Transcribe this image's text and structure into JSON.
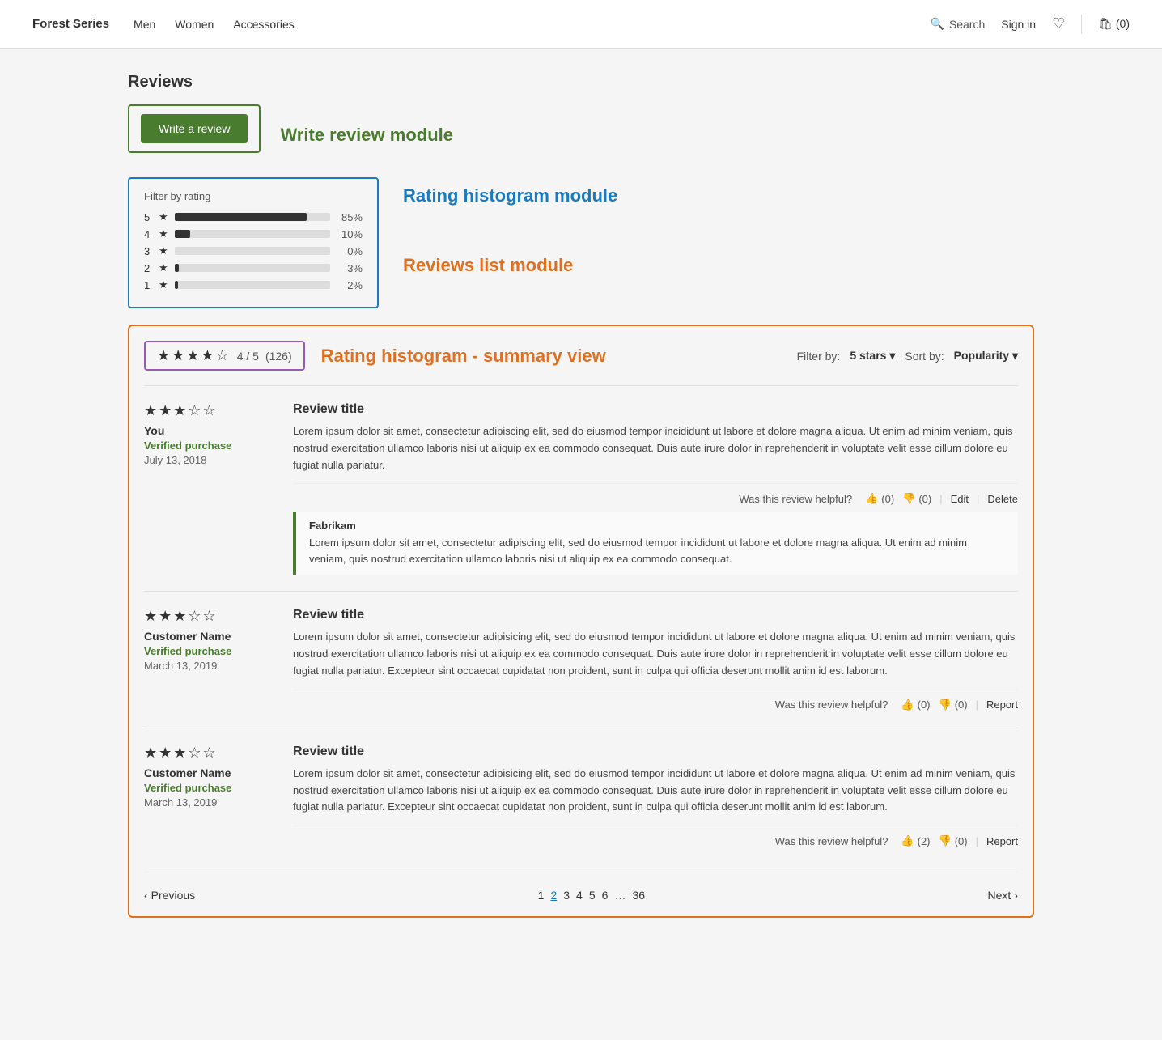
{
  "nav": {
    "brand": "Forest Series",
    "links": [
      "Men",
      "Women",
      "Accessories"
    ],
    "search_label": "Search",
    "signin_label": "Sign in",
    "cart_label": "(0)"
  },
  "page": {
    "reviews_title": "Reviews",
    "write_review_btn": "Write a review",
    "write_review_module_label": "Write review module",
    "histogram_module_label": "Rating histogram module",
    "reviews_list_module_label": "Reviews list module",
    "histogram_summary_label": "Rating histogram - summary view",
    "histogram": {
      "title": "Filter by rating",
      "rows": [
        {
          "num": "5",
          "pct": 85,
          "pct_label": "85%"
        },
        {
          "num": "4",
          "pct": 10,
          "pct_label": "10%"
        },
        {
          "num": "3",
          "pct": 0,
          "pct_label": "0%"
        },
        {
          "num": "2",
          "pct": 3,
          "pct_label": "3%"
        },
        {
          "num": "1",
          "pct": 2,
          "pct_label": "2%"
        }
      ]
    },
    "summary": {
      "score": "4 / 5",
      "count": "(126)"
    },
    "filter_by_label": "Filter by:",
    "filter_by_value": "5 stars ▾",
    "sort_by_label": "Sort by:",
    "sort_by_value": "Popularity ▾",
    "reviews": [
      {
        "stars": 3,
        "author": "You",
        "verified": "Verified purchase",
        "date": "July 13, 2018",
        "title": "Review title",
        "body": "Lorem ipsum dolor sit amet, consectetur adipiscing elit, sed do eiusmod tempor incididunt ut labore et dolore magna aliqua. Ut enim ad minim veniam, quis nostrud exercitation ullamco laboris nisi ut aliquip ex ea commodo consequat. Duis aute irure dolor in reprehenderit in voluptate velit esse cillum dolore eu fugiat nulla pariatur.",
        "helpful_label": "Was this review helpful?",
        "thumbs_up": "(0)",
        "thumbs_down": "(0)",
        "actions": [
          "Edit",
          "Delete"
        ],
        "response": {
          "author": "Fabrikam",
          "body": "Lorem ipsum dolor sit amet, consectetur adipiscing elit, sed do eiusmod tempor incididunt ut labore et dolore magna aliqua. Ut enim ad minim veniam, quis nostrud exercitation ullamco laboris nisi ut aliquip ex ea commodo consequat."
        }
      },
      {
        "stars": 3,
        "author": "Customer Name",
        "verified": "Verified purchase",
        "date": "March 13, 2019",
        "title": "Review title",
        "body": "Lorem ipsum dolor sit amet, consectetur adipisicing elit, sed do eiusmod tempor incididunt ut labore et dolore magna aliqua. Ut enim ad minim veniam, quis nostrud exercitation ullamco laboris nisi ut aliquip ex ea commodo consequat. Duis aute irure dolor in reprehenderit in voluptate velit esse cillum dolore eu fugiat nulla pariatur. Excepteur sint occaecat cupidatat non proident, sunt in culpa qui officia deserunt mollit anim id est laborum.",
        "helpful_label": "Was this review helpful?",
        "thumbs_up": "(0)",
        "thumbs_down": "(0)",
        "actions": [
          "Report"
        ],
        "response": null
      },
      {
        "stars": 3,
        "author": "Customer Name",
        "verified": "Verified purchase",
        "date": "March 13, 2019",
        "title": "Review title",
        "body": "Lorem ipsum dolor sit amet, consectetur adipisicing elit, sed do eiusmod tempor incididunt ut labore et dolore magna aliqua. Ut enim ad minim veniam, quis nostrud exercitation ullamco laboris nisi ut aliquip ex ea commodo consequat. Duis aute irure dolor in reprehenderit in voluptate velit esse cillum dolore eu fugiat nulla pariatur. Excepteur sint occaecat cupidatat non proident, sunt in culpa qui officia deserunt mollit anim id est laborum.",
        "helpful_label": "Was this review helpful?",
        "thumbs_up": "(2)",
        "thumbs_down": "(0)",
        "actions": [
          "Report"
        ],
        "response": null
      }
    ],
    "pagination": {
      "prev_label": "Previous",
      "next_label": "Next",
      "pages": [
        "1",
        "2",
        "3",
        "4",
        "5",
        "6",
        "…",
        "36"
      ],
      "active_page": "2"
    }
  }
}
